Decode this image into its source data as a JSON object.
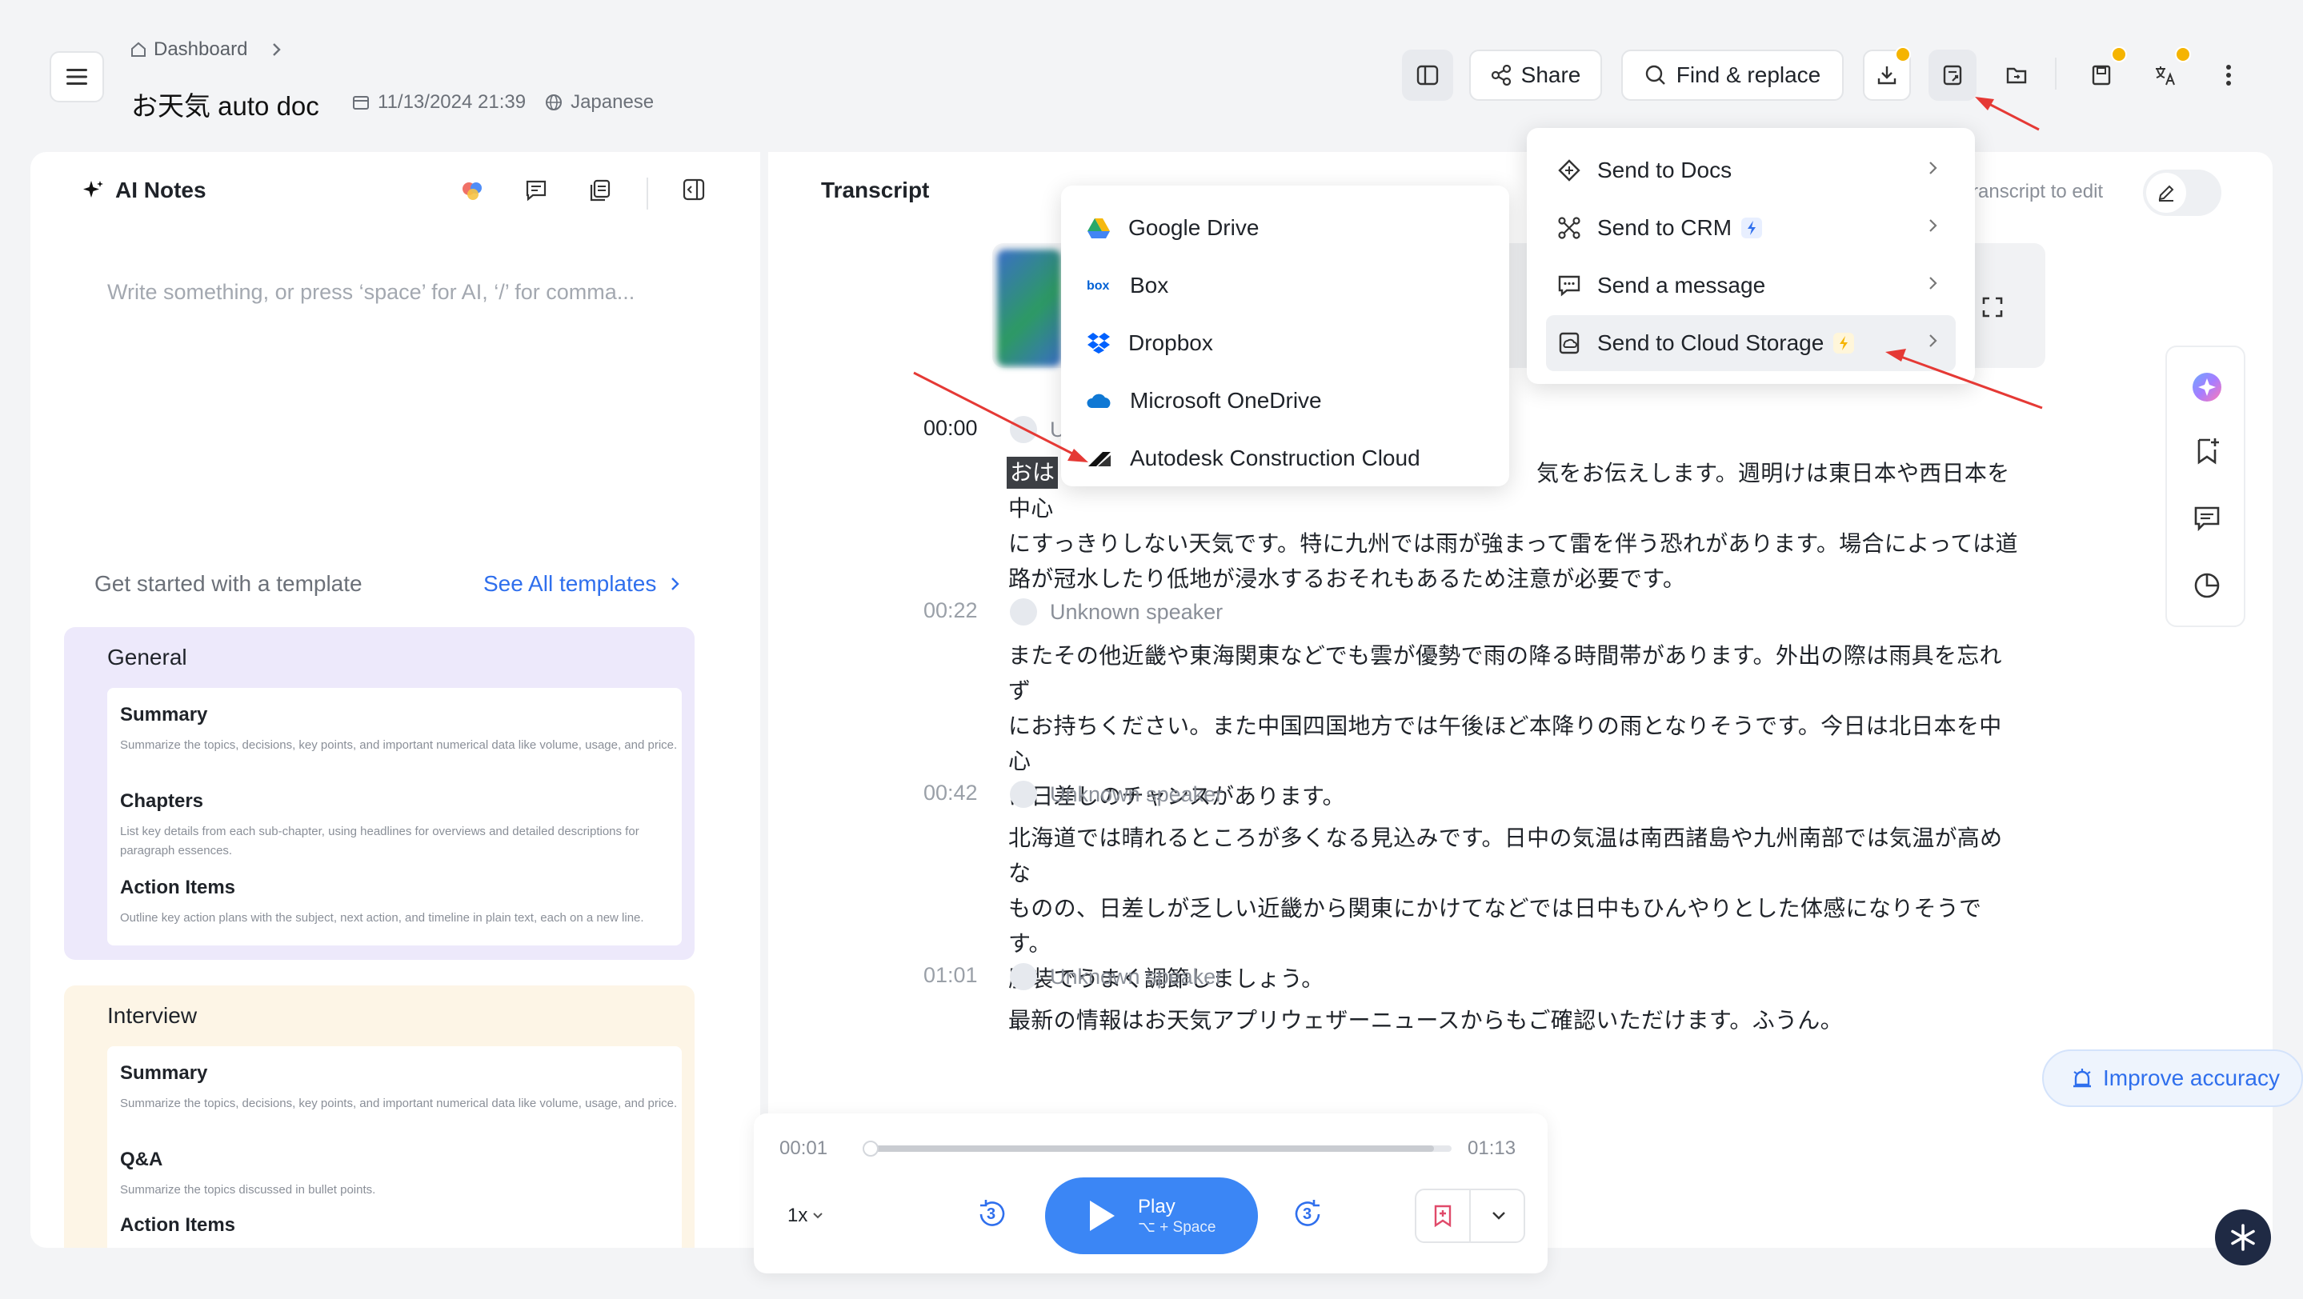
{
  "header": {
    "breadcrumb": "Dashboard",
    "title": "お天気 auto doc",
    "date": "11/13/2024 21:39",
    "language": "Japanese",
    "share_label": "Share",
    "find_replace_label": "Find & replace"
  },
  "ai_notes": {
    "title": "AI Notes",
    "placeholder": "Write something, or press ‘space’ for AI, ‘/’ for comma...",
    "template_prompt": "Get started with a template",
    "see_all": "See All templates",
    "general": {
      "title": "General",
      "items": [
        {
          "name": "Summary",
          "desc": "Summarize the topics, decisions, key points, and important numerical data like volume, usage, and price."
        },
        {
          "name": "Chapters",
          "desc": "List key details from each sub-chapter, using headlines for overviews and detailed descriptions for paragraph essences."
        },
        {
          "name": "Action Items",
          "desc": "Outline key action plans with the subject, next action, and timeline in plain text, each on a new line."
        }
      ]
    },
    "interview": {
      "title": "Interview",
      "items": [
        {
          "name": "Summary",
          "desc": "Summarize the topics, decisions, key points, and important numerical data like volume, usage, and price."
        },
        {
          "name": "Q&A",
          "desc": "Summarize the topics discussed in bullet points."
        },
        {
          "name": "Action Items",
          "desc": ""
        }
      ]
    }
  },
  "transcript": {
    "title": "Transcript",
    "edit_hint": "ranscript to edit",
    "segments": [
      {
        "time": "00:00",
        "speaker": "U",
        "text": "気をお伝えします。週明けは東日本や西日本を中心",
        "line2": "にすっきりしない天気です。特に九州では雨が強まって雷を伴う恐れがあります。場合によっては道",
        "line3": "路が冠水したり低地が浸水するおそれもあるため注意が必要です。",
        "highlight": "おは"
      },
      {
        "time": "00:22",
        "speaker": "Unknown speaker",
        "text": "またその他近畿や東海関東などでも雲が優勢で雨の降る時間帯があります。外出の際は雨具を忘れず",
        "line2": "にお持ちください。また中国四国地方では午後ほど本降りの雨となりそうです。今日は北日本を中心",
        "line3": "に日差しのチャンスがあります。"
      },
      {
        "time": "00:42",
        "speaker": "Unknown speaker",
        "text": "北海道では晴れるところが多くなる見込みです。日中の気温は南西諸島や九州南部では気温が高めな",
        "line2": "ものの、日差しが乏しい近畿から関東にかけてなどでは日中もひんやりとした体感になりそうです。",
        "line3": "服装でうまく調節しましょう。"
      },
      {
        "time": "01:01",
        "speaker": "Unknown speaker",
        "text": "最新の情報はお天気アプリウェザーニュースからもご確認いただけます。ふうん。",
        "line2": "",
        "line3": ""
      }
    ]
  },
  "export_menu": {
    "items": [
      "Send to Docs",
      "Send to CRM",
      "Send a message",
      "Send to Cloud Storage"
    ]
  },
  "cloud_menu": {
    "items": [
      "Google Drive",
      "Box",
      "Dropbox",
      "Microsoft OneDrive",
      "Autodesk Construction Cloud"
    ]
  },
  "player": {
    "current": "00:01",
    "total": "01:13",
    "speed": "1x",
    "play_label": "Play",
    "shortcut": "⌥ + Space",
    "skip_back": "3",
    "skip_forward": "3",
    "progress": 0.01
  },
  "improve_accuracy": "Improve accuracy",
  "colors": {
    "accent": "#2f6fed",
    "play": "#3b86f5",
    "arrow": "#e53935",
    "badge": "#f5b400"
  }
}
